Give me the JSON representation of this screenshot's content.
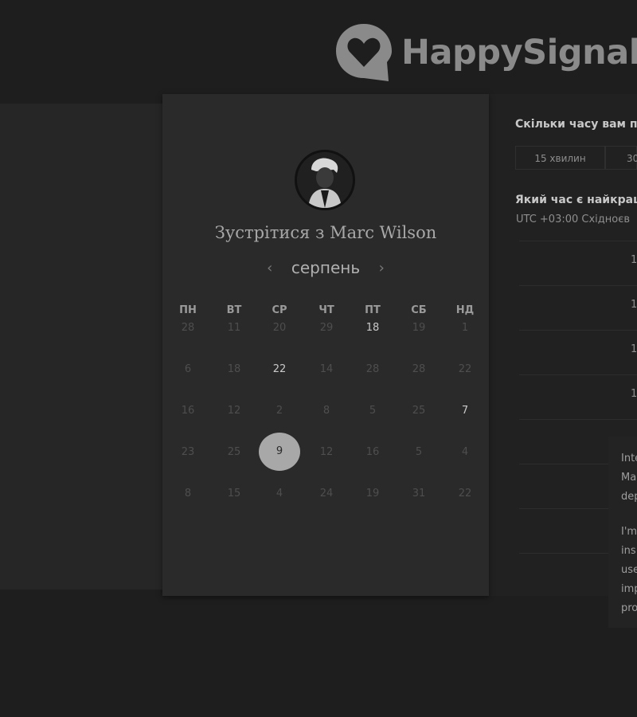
{
  "logo": {
    "text": "HappySignals"
  },
  "card": {
    "title": "Зустрітися з Marc Wilson",
    "month": "серпень",
    "prev_arrow": "‹",
    "next_arrow": "›",
    "weekdays": [
      "ПН",
      "ВТ",
      "СР",
      "ЧТ",
      "ПТ",
      "СБ",
      "НД"
    ],
    "weeks": [
      [
        "28",
        "11",
        "20",
        "29",
        "18",
        "19",
        "1"
      ],
      [
        "6",
        "18",
        "22",
        "14",
        "28",
        "28",
        "22"
      ],
      [
        "16",
        "12",
        "2",
        "8",
        "5",
        "25",
        "7"
      ],
      [
        "23",
        "25",
        "9",
        "12",
        "16",
        "5",
        "4"
      ],
      [
        "8",
        "15",
        "4",
        "24",
        "19",
        "31",
        "22"
      ]
    ]
  },
  "panel": {
    "duration_question": "Скільки часу вам п",
    "durations": [
      "15 хвилин",
      "30"
    ],
    "time_question": "Який час є найкращ",
    "timezone": "UTC +03:00 Східноєв",
    "slots": [
      "1",
      "1",
      "1",
      "1",
      ""
    ]
  },
  "popup": {
    "lines": [
      "Inte",
      "Ma",
      "dep",
      "",
      "I'm",
      "ins",
      "use",
      "imp",
      "pro"
    ]
  }
}
